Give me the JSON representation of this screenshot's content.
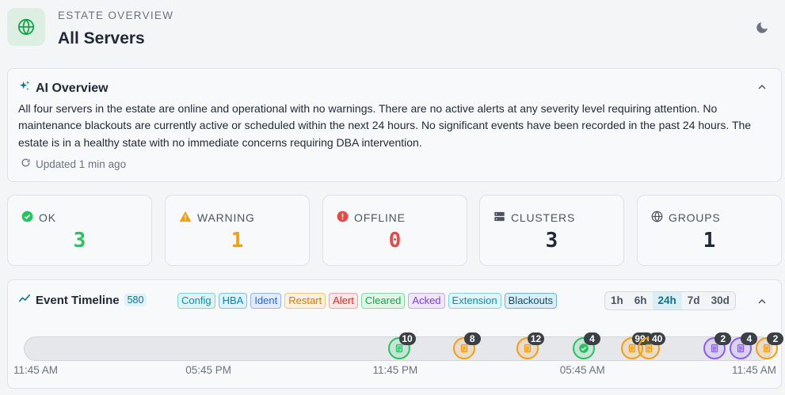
{
  "header": {
    "eyebrow": "ESTATE OVERVIEW",
    "title": "All Servers",
    "icon": "globe-icon",
    "theme_icon": "moon-icon"
  },
  "ai_overview": {
    "title": "AI Overview",
    "icon": "sparkles-icon",
    "text": "All four servers in the estate are online and operational with no warnings. There are no active alerts at any severity level requiring attention. No maintenance blackouts are currently active or scheduled within the next 24 hours. No significant events have been recorded in the past 24 hours. The estate is in a healthy state with no immediate concerns requiring DBA intervention.",
    "updated": "Updated 1 min ago"
  },
  "stats": [
    {
      "label": "OK",
      "value": "3",
      "icon": "check-circle-icon",
      "color": "#22c55e"
    },
    {
      "label": "WARNING",
      "value": "1",
      "icon": "warning-triangle-icon",
      "color": "#f59e0b"
    },
    {
      "label": "OFFLINE",
      "value": "0",
      "icon": "error-circle-icon",
      "color": "#ef4444"
    },
    {
      "label": "CLUSTERS",
      "value": "3",
      "icon": "server-stack-icon",
      "color": "#1f2937"
    },
    {
      "label": "GROUPS",
      "value": "1",
      "icon": "globe-icon",
      "color": "#1f2937"
    }
  ],
  "timeline": {
    "title": "Event Timeline",
    "count": "580",
    "filters": [
      {
        "label": "Config",
        "color": "#0891b2",
        "bg": "#e0f4f8",
        "border": "#7dd3e4"
      },
      {
        "label": "HBA",
        "color": "#0284c7",
        "bg": "#e0f2fe",
        "border": "#7cc4ec"
      },
      {
        "label": "Ident",
        "color": "#2563eb",
        "bg": "#e3ecfd",
        "border": "#93b4f5"
      },
      {
        "label": "Restart",
        "color": "#d97706",
        "bg": "#fdf2df",
        "border": "#f5c57a"
      },
      {
        "label": "Alert",
        "color": "#dc2626",
        "bg": "#fde6e6",
        "border": "#f3a3a3"
      },
      {
        "label": "Cleared",
        "color": "#16a34a",
        "bg": "#e2f6e8",
        "border": "#86d9a3"
      },
      {
        "label": "Acked",
        "color": "#7c3aed",
        "bg": "#efe7fd",
        "border": "#c4a8f5"
      },
      {
        "label": "Extension",
        "color": "#0891b2",
        "bg": "#e0f6f9",
        "border": "#7fd7e6"
      },
      {
        "label": "Blackouts",
        "color": "#0c4a6e",
        "bg": "#dbeef8",
        "border": "#6fb3d8"
      }
    ],
    "ranges": [
      "1h",
      "6h",
      "24h",
      "7d",
      "30d"
    ],
    "active_range": "24h",
    "ticks": [
      "11:45 AM",
      "05:45 PM",
      "11:45 PM",
      "05:45 AM",
      "11:45 AM"
    ],
    "events": [
      {
        "count": "10",
        "color": "#22c55e",
        "icon": "document-icon",
        "pos": 0.5
      },
      {
        "count": "8",
        "color": "#f59e0b",
        "icon": "document-icon",
        "pos": 0.587
      },
      {
        "count": "12",
        "color": "#f59e0b",
        "icon": "document-icon",
        "pos": 0.672
      },
      {
        "count": "4",
        "color": "#22c55e",
        "icon": "check-icon",
        "pos": 0.747
      },
      {
        "count": "99+",
        "color": "#f59e0b",
        "icon": "document-icon",
        "pos": 0.812
      },
      {
        "count": "40",
        "color": "#f59e0b",
        "icon": "document-icon",
        "pos": 0.834
      },
      {
        "count": "2",
        "color": "#8b5cf6",
        "icon": "document-icon",
        "pos": 0.922
      },
      {
        "count": "4",
        "color": "#8b5cf6",
        "icon": "document-icon",
        "pos": 0.957
      },
      {
        "count": "2",
        "color": "#f59e0b",
        "icon": "document-icon",
        "pos": 0.992
      }
    ]
  }
}
